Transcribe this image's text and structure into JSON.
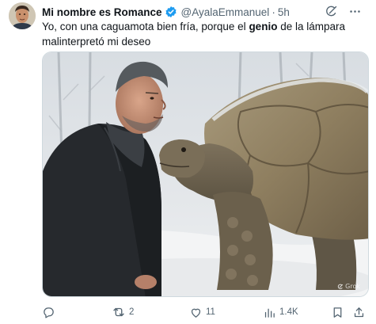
{
  "tweet": {
    "display_name": "Mi nombre es Romance",
    "handle": "@AyalaEmmanuel",
    "separator": "·",
    "time": "5h",
    "text_before": "Yo, con una caguamota bien fría, porque el ",
    "text_bold": "genio",
    "text_after": " de la lámpara malinterpretó mi deseo",
    "watermark": "Grok"
  },
  "actions": {
    "replies": "",
    "retweets": "2",
    "likes": "11",
    "views": "1.4K"
  },
  "colors": {
    "text": "#0f1419",
    "secondary": "#536471",
    "verified": "#1d9bf0",
    "border": "#cfd9de"
  },
  "icons": [
    "verified-badge-icon",
    "grok-icon",
    "more-icon",
    "reply-icon",
    "retweet-icon",
    "like-icon",
    "views-icon",
    "bookmark-icon",
    "share-icon"
  ]
}
